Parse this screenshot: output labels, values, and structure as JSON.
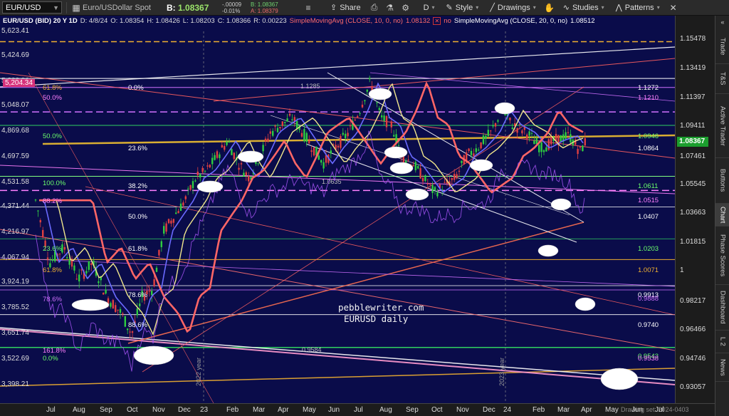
{
  "toolbar": {
    "symbol": "EUR/USD",
    "description": "Euro/USDollar Spot",
    "bid_prefix": "B:",
    "bid": "1.08367",
    "change_abs": "-.00009",
    "change_pct": "-0.01%",
    "bid_small": "B: 1.08367",
    "ask_small": "A: 1.08379",
    "share": "Share",
    "period": "D",
    "style": "Style",
    "drawings": "Drawings",
    "studies": "Studies",
    "patterns": "Patterns"
  },
  "info_row": {
    "symbol": "EUR/USD (BID) 20 Y 1D",
    "date": "D: 4/8/24",
    "open": "O: 1.08354",
    "high": "H: 1.08426",
    "low": "L: 1.08203",
    "close": "C: 1.08366",
    "range": "R: 0.00223",
    "sma10": "SimpleMovingAvg (CLOSE, 10, 0, no)",
    "sma10_val": "1.08132",
    "sma10_flag": "no",
    "sma20": "SimpleMovingAvg (CLOSE, 20, 0, no)",
    "sma20_val": "1.08512"
  },
  "left_axis": [
    "5,623.41",
    "5,424.69",
    "5,233.96",
    "5,048.07",
    "4,869.68",
    "4,697.59",
    "4,531.58",
    "4,371.44",
    "4,216.97",
    "4,067.94",
    "3,924.19",
    "3,785.52",
    "3,651.74",
    "3,522.69",
    "3,398.21"
  ],
  "left_axis_badge": "5,204.34",
  "right_axis": [
    "1.15478",
    "1.13419",
    "1.11397",
    "1.09411",
    "1.07461",
    "1.05545",
    "1.03663",
    "1.01815",
    "1",
    "0.98217",
    "0.96466",
    "0.94746",
    "0.93057"
  ],
  "current_price": "1.08367",
  "x_axis": [
    "Jul",
    "Aug",
    "Sep",
    "Oct",
    "Nov",
    "Dec",
    "23",
    "Feb",
    "Mar",
    "Apr",
    "May",
    "Jun",
    "Jul",
    "Aug",
    "Sep",
    "Oct",
    "Nov",
    "Dec",
    "24",
    "Feb",
    "Mar",
    "Apr",
    "May",
    "Jun",
    "Jul"
  ],
  "fib_left": [
    "0.0%",
    "23.6%",
    "38.2%",
    "50.0%",
    "61.8%",
    "78.6%",
    "88.6%",
    "0.0%"
  ],
  "fib_left2": [
    "61.8%",
    "50.0%",
    "50.0%",
    "100.0%",
    "88.2%",
    "23.6%",
    "61.8%",
    "78.6%",
    "161.8%"
  ],
  "level_labels": [
    "1.1272",
    "1.1210",
    "1.0946",
    "1.0864",
    "1.0611",
    "1.0515",
    "1.0407",
    "1.0203",
    "1.0071",
    "0.9913",
    "0.9888",
    "0.9740",
    "0.9543",
    "0.9538"
  ],
  "chart_notes": [
    "1.1285",
    "1.0635",
    "0.9584"
  ],
  "year_labels": [
    "2022 year",
    "2023 year"
  ],
  "watermark": [
    "pebblewriter.com",
    "EURUSD daily"
  ],
  "sidebar_tabs": [
    "Trade",
    "T&S",
    "Active Trader",
    "Buttons",
    "Chart",
    "Phase Scores",
    "Dashboard",
    "L 2",
    "News"
  ],
  "drawing_set": "Drawing set: 2024-0403",
  "colors": {
    "background": "#0a0c4a",
    "candle_up": "#2ecc40",
    "candle_down": "#e04040",
    "sma_pink": "#ff6666",
    "sma_yellow": "#f0e68c",
    "spx_purple": "#a855f7",
    "fib_gold": "#f0b030",
    "current_price_bg": "#1b9e2e"
  }
}
